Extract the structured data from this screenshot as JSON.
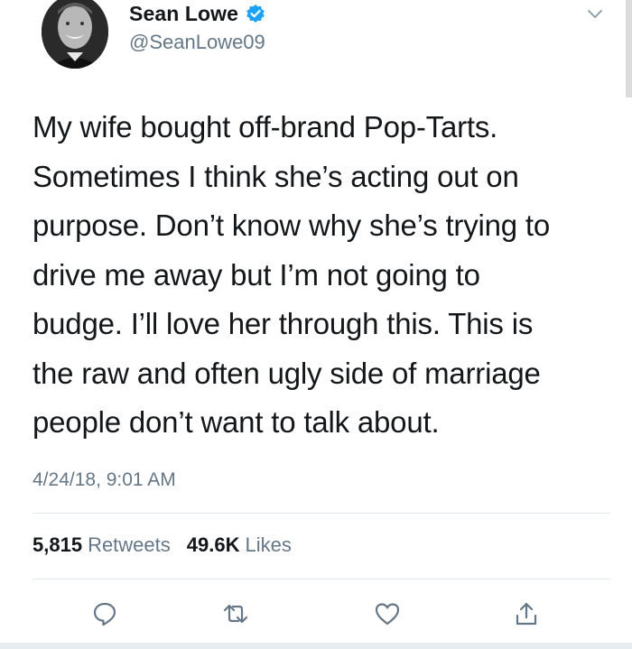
{
  "author": {
    "display_name": "Sean Lowe",
    "handle": "@SeanLowe09",
    "verified": true
  },
  "tweet": {
    "text_lines": [
      "My wife bought off-brand Pop-Tarts.",
      "Sometimes I think she’s acting out on",
      "purpose. Don’t know why she’s trying to",
      "drive me away but I’m not going to",
      "budge. I’ll love her through this. This is",
      "the raw and often ugly side of marriage",
      "people don’t want to talk about."
    ],
    "timestamp": "4/24/18, 9:01 AM"
  },
  "stats": {
    "retweets_count": "5,815",
    "retweets_label": "Retweets",
    "likes_count": "49.6K",
    "likes_label": "Likes"
  },
  "icons": {
    "verified": "verified-badge-icon",
    "more": "chevron-down-icon",
    "reply": "reply-icon",
    "retweet": "retweet-icon",
    "like": "heart-icon",
    "share": "share-icon"
  },
  "colors": {
    "text": "#14171a",
    "secondary": "#657786",
    "verified": "#1da1f2",
    "divider": "#e1e8ed"
  }
}
